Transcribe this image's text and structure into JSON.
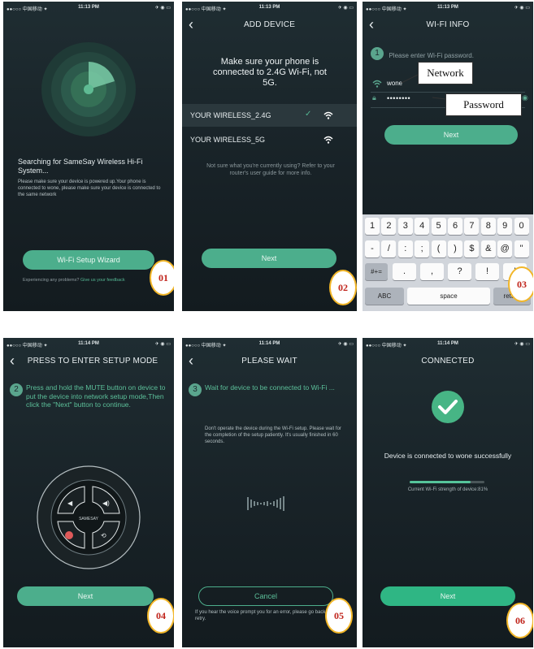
{
  "status": {
    "carrier": "●●○○○ 中国移动 ✦",
    "time1": "11:13 PM",
    "time2": "11:14 PM",
    "battery": "✈ ◉ ▭"
  },
  "s1": {
    "status": "Searching for SameSay Wireless Hi-Fi System...",
    "desc": "Please make sure your device is powered up.Your phone is connected to wone, please make sure your device is connected to the same network",
    "button": "Wi-Fi Setup Wizard",
    "problem": "Experiencing any problems?",
    "link": "Give us your feedback",
    "badge": "01"
  },
  "s2": {
    "title": "ADD DEVICE",
    "heading": "Make sure your phone is connected to 2.4G Wi-Fi, not 5G.",
    "networks": [
      {
        "name": "YOUR WIRELESS_2.4G",
        "selected": true,
        "check": "✓"
      },
      {
        "name": "YOUR WIRELESS_5G",
        "selected": false,
        "check": ""
      }
    ],
    "help": "Not sure what you're currently using? Refer to your router's user guide for more info.",
    "button": "Next",
    "badge": "02"
  },
  "s3": {
    "title": "WI-FI INFO",
    "step": "1",
    "prompt": "Please enter Wi-Fi password.",
    "network": "wone",
    "password": "••••••••",
    "button": "Next",
    "callout_network": "Network",
    "callout_password": "Password",
    "badge": "03",
    "keys_row1": [
      "1",
      "2",
      "3",
      "4",
      "5",
      "6",
      "7",
      "8",
      "9",
      "0"
    ],
    "keys_row2": [
      "-",
      "/",
      ":",
      ";",
      "(",
      ")",
      "$",
      "&",
      "@",
      "\""
    ],
    "key_symbols": "#+=",
    "keys_row3": [
      ".",
      ",",
      "?",
      "!",
      "'"
    ],
    "key_abc": "ABC",
    "key_space": "space",
    "key_return": "return"
  },
  "s4": {
    "title": "PRESS TO ENTER SETUP MODE",
    "step": "2",
    "instruction": "Press and hold the MUTE button on device to put the device into network setup mode,Then click the \"Next\" button to continue.",
    "brand": "SAMESAY",
    "button": "Next",
    "badge": "04"
  },
  "s5": {
    "title": "PLEASE WAIT",
    "step": "3",
    "wait": "Wait for device to be connected to Wi-Fi ...",
    "note": "Don't operate the device during the Wi-Fi setup. Please wait for the completion of the setup patiently. It's usually finished in 60 seconds.",
    "button": "Cancel",
    "retry": "If you hear the voice prompt you for an error, please go back and retry.",
    "badge": "05"
  },
  "s6": {
    "title": "CONNECTED",
    "message": "Device is connected to wone successfully",
    "strength": "Current Wi-Fi strength of device:81%",
    "strength_percent": 81,
    "button": "Next",
    "badge": "06"
  },
  "colors": {
    "accent": "#4cae8c",
    "badge_border": "#f2b628",
    "badge_text": "#c0231a"
  }
}
